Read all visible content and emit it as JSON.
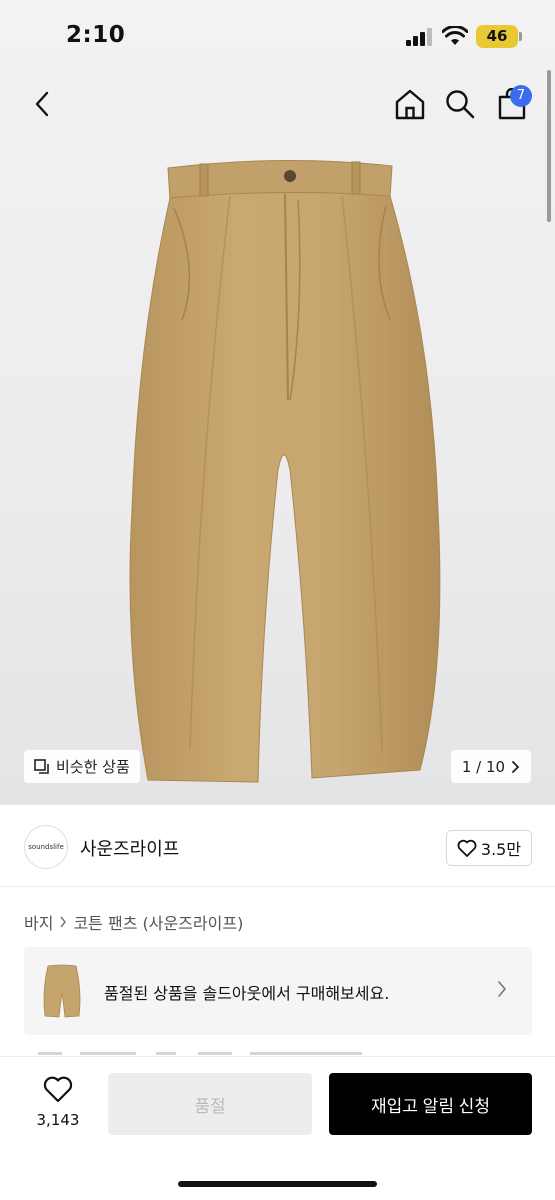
{
  "status_bar": {
    "time": "2:10",
    "battery": "46"
  },
  "nav": {
    "cart_count": "7"
  },
  "gallery": {
    "similar_label": "비슷한 상품",
    "page_indicator": "1 / 10"
  },
  "brand": {
    "logo_text": "soundslife",
    "name": "사운즈라이프",
    "likes": "3.5만"
  },
  "breadcrumb": {
    "category": "바지",
    "item": "코튼 팬츠 (사운즈라이프)"
  },
  "soldout_banner": {
    "text": "품절된 상품을 솔드아웃에서 구매해보세요."
  },
  "bottom_bar": {
    "wish_count": "3,143",
    "soldout_label": "품절",
    "restock_label": "재입고 알림 신청"
  },
  "colors": {
    "accent_badge": "#3b6cf0",
    "primary_button": "#000000",
    "product_khaki": "#c5a46e"
  }
}
